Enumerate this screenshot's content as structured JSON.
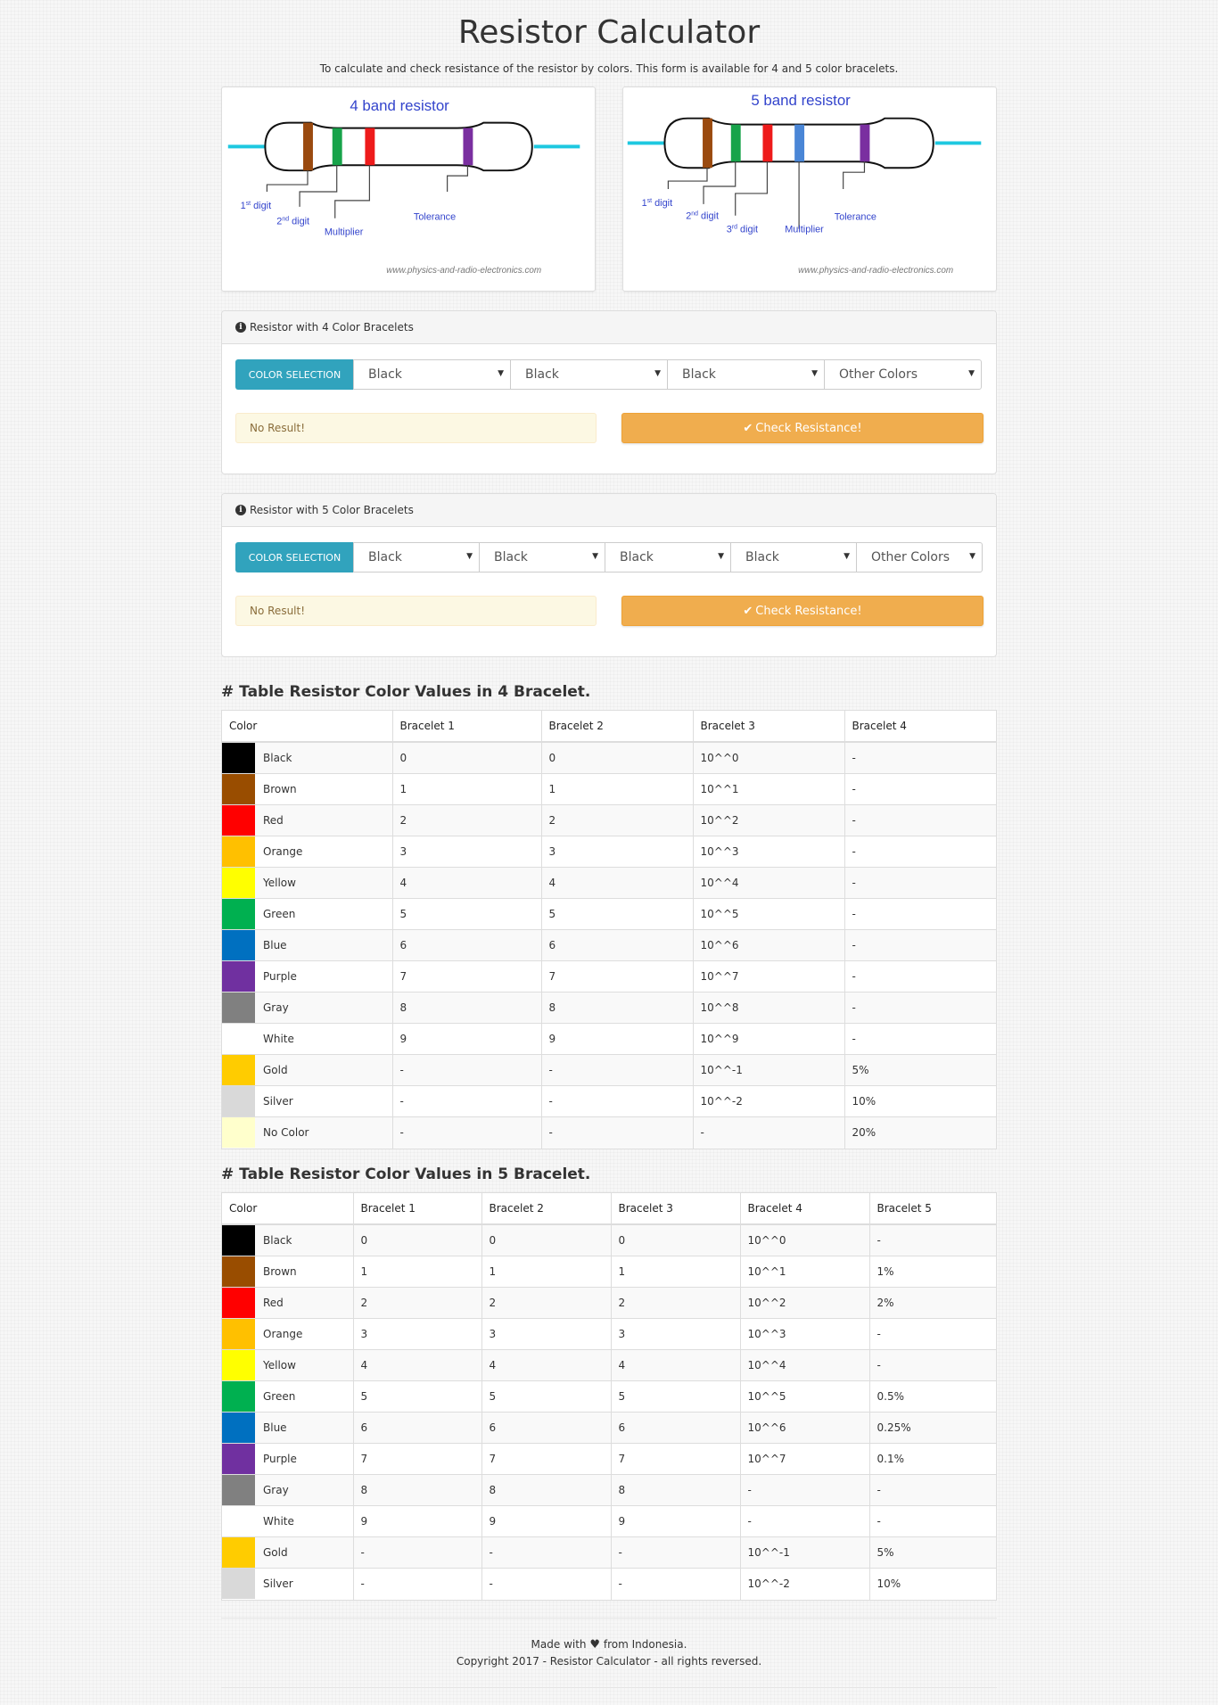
{
  "page": {
    "title": "Resistor Calculator",
    "subtitle": "To calculate and check resistance of the resistor by colors. This form is available for 4 and 5 color bracelets."
  },
  "diagrams": {
    "four": {
      "title": "4 band resistor",
      "labels": {
        "digit1": "1",
        "digit1_sup": "st",
        "digit1_text": " digit",
        "digit2": "2",
        "digit2_sup": "nd",
        "digit2_text": " digit",
        "multiplier": "Multiplier",
        "tolerance": "Tolerance"
      },
      "credit": "www.physics-and-radio-electronics.com",
      "band_colors": [
        "#9a4a0f",
        "#17a34a",
        "#ee1b1b",
        "#7a2fa0"
      ],
      "lead_color": "#1ec8e0"
    },
    "five": {
      "title": "5 band resistor",
      "labels": {
        "digit1": "1",
        "digit1_sup": "st",
        "digit1_text": " digit",
        "digit2": "2",
        "digit2_sup": "nd",
        "digit2_text": " digit",
        "digit3": "3",
        "digit3_sup": "rd",
        "digit3_text": " digit",
        "multiplier": "Multiplier",
        "tolerance": "Tolerance"
      },
      "credit": "www.physics-and-radio-electronics.com",
      "band_colors": [
        "#9a4a0f",
        "#17a34a",
        "#ee1b1b",
        "#4a86d6",
        "#7a2fa0"
      ],
      "lead_color": "#1ec8e0"
    }
  },
  "panel4": {
    "heading": "Resistor with 4 Color Bracelets",
    "addon": "COLOR SELECTION",
    "selects": [
      "Black",
      "Black",
      "Black",
      "Other Colors"
    ],
    "result": "No Result!",
    "button": "Check Resistance!"
  },
  "panel5": {
    "heading": "Resistor with 5 Color Bracelets",
    "addon": "COLOR SELECTION",
    "selects": [
      "Black",
      "Black",
      "Black",
      "Black",
      "Other Colors"
    ],
    "result": "No Result!",
    "button": "Check Resistance!"
  },
  "table4": {
    "title": "# Table Resistor Color Values in 4 Bracelet.",
    "headers": [
      "Color",
      "Bracelet 1",
      "Bracelet 2",
      "Bracelet 3",
      "Bracelet 4"
    ],
    "rows": [
      {
        "name": "Black",
        "swatch": "#000000",
        "cells": [
          "0",
          "0",
          "10^^0",
          "-"
        ]
      },
      {
        "name": "Brown",
        "swatch": "#994d00",
        "cells": [
          "1",
          "1",
          "10^^1",
          "-"
        ]
      },
      {
        "name": "Red",
        "swatch": "#ff0000",
        "cells": [
          "2",
          "2",
          "10^^2",
          "-"
        ]
      },
      {
        "name": "Orange",
        "swatch": "#ffc000",
        "cells": [
          "3",
          "3",
          "10^^3",
          "-"
        ]
      },
      {
        "name": "Yellow",
        "swatch": "#ffff00",
        "cells": [
          "4",
          "4",
          "10^^4",
          "-"
        ]
      },
      {
        "name": "Green",
        "swatch": "#00b050",
        "cells": [
          "5",
          "5",
          "10^^5",
          "-"
        ]
      },
      {
        "name": "Blue",
        "swatch": "#0070c0",
        "cells": [
          "6",
          "6",
          "10^^6",
          "-"
        ]
      },
      {
        "name": "Purple",
        "swatch": "#7030a0",
        "cells": [
          "7",
          "7",
          "10^^7",
          "-"
        ]
      },
      {
        "name": "Gray",
        "swatch": "#808080",
        "cells": [
          "8",
          "8",
          "10^^8",
          "-"
        ]
      },
      {
        "name": "White",
        "swatch": "#ffffff",
        "cells": [
          "9",
          "9",
          "10^^9",
          "-"
        ]
      },
      {
        "name": "Gold",
        "swatch": "#ffcc00",
        "cells": [
          "-",
          "-",
          "10^^-1",
          "5%"
        ]
      },
      {
        "name": "Silver",
        "swatch": "#d9d9d9",
        "cells": [
          "-",
          "-",
          "10^^-2",
          "10%"
        ]
      },
      {
        "name": "No Color",
        "swatch": "#ffffcc",
        "cells": [
          "-",
          "-",
          "-",
          "20%"
        ]
      }
    ]
  },
  "table5": {
    "title": "# Table Resistor Color Values in 5 Bracelet.",
    "headers": [
      "Color",
      "Bracelet 1",
      "Bracelet 2",
      "Bracelet 3",
      "Bracelet 4",
      "Bracelet 5"
    ],
    "rows": [
      {
        "name": "Black",
        "swatch": "#000000",
        "cells": [
          "0",
          "0",
          "0",
          "10^^0",
          "-"
        ]
      },
      {
        "name": "Brown",
        "swatch": "#994d00",
        "cells": [
          "1",
          "1",
          "1",
          "10^^1",
          "1%"
        ]
      },
      {
        "name": "Red",
        "swatch": "#ff0000",
        "cells": [
          "2",
          "2",
          "2",
          "10^^2",
          "2%"
        ]
      },
      {
        "name": "Orange",
        "swatch": "#ffc000",
        "cells": [
          "3",
          "3",
          "3",
          "10^^3",
          "-"
        ]
      },
      {
        "name": "Yellow",
        "swatch": "#ffff00",
        "cells": [
          "4",
          "4",
          "4",
          "10^^4",
          "-"
        ]
      },
      {
        "name": "Green",
        "swatch": "#00b050",
        "cells": [
          "5",
          "5",
          "5",
          "10^^5",
          "0.5%"
        ]
      },
      {
        "name": "Blue",
        "swatch": "#0070c0",
        "cells": [
          "6",
          "6",
          "6",
          "10^^6",
          "0.25%"
        ]
      },
      {
        "name": "Purple",
        "swatch": "#7030a0",
        "cells": [
          "7",
          "7",
          "7",
          "10^^7",
          "0.1%"
        ]
      },
      {
        "name": "Gray",
        "swatch": "#808080",
        "cells": [
          "8",
          "8",
          "8",
          "-",
          "-"
        ]
      },
      {
        "name": "White",
        "swatch": "#ffffff",
        "cells": [
          "9",
          "9",
          "9",
          "-",
          "-"
        ]
      },
      {
        "name": "Gold",
        "swatch": "#ffcc00",
        "cells": [
          "-",
          "-",
          "-",
          "10^^-1",
          "5%"
        ]
      },
      {
        "name": "Silver",
        "swatch": "#d9d9d9",
        "cells": [
          "-",
          "-",
          "-",
          "10^^-2",
          "10%"
        ]
      }
    ]
  },
  "footer": {
    "made_prefix": "Made with",
    "made_suffix": "from Indonesia.",
    "copyright": "Copyright 2017 - Resistor Calculator - all rights reversed."
  },
  "icons": {
    "info": "info-circle-icon",
    "check": "check-icon",
    "caret": "caret-down-icon",
    "heart": "heart-icon"
  },
  "colors": {
    "addon_bg": "#31a3bd",
    "button_bg": "#f0ad4e",
    "result_bg": "#fcf8e3",
    "result_text": "#8a6d3b"
  }
}
